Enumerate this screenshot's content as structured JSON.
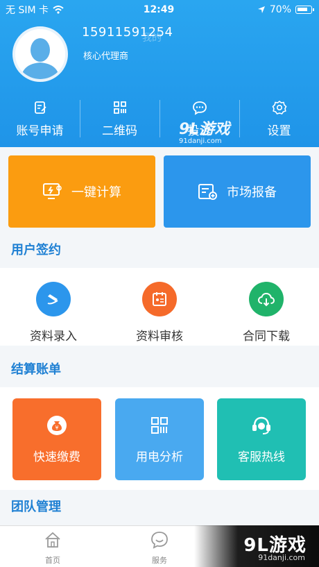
{
  "status_bar": {
    "carrier": "无 SIM 卡",
    "time": "12:49",
    "battery": "70%"
  },
  "profile": {
    "phone": "15911591254",
    "role": "核心代理商",
    "faint_label": "我的"
  },
  "top_menu": [
    {
      "label": "账号申请",
      "icon": "edit-icon"
    },
    {
      "label": "二维码",
      "icon": "qrcode-icon"
    },
    {
      "label": "投诉",
      "icon": "chat-icon"
    },
    {
      "label": "设置",
      "icon": "gear-icon"
    }
  ],
  "actions": {
    "calc": "一键计算",
    "report": "市场报备"
  },
  "section_signing": {
    "title": "用户签约",
    "items": [
      {
        "label": "资料录入",
        "color": "#2c96ec"
      },
      {
        "label": "资料审核",
        "color": "#f56a2a"
      },
      {
        "label": "合同下载",
        "color": "#20b36a"
      }
    ]
  },
  "section_billing": {
    "title": "结算账单",
    "tiles": [
      {
        "label": "快速缴费",
        "color": "#f86e2c"
      },
      {
        "label": "用电分析",
        "color": "#49a9f0"
      },
      {
        "label": "客服热线",
        "color": "#20bfb3"
      }
    ]
  },
  "section_team": {
    "title": "团队管理"
  },
  "tabbar": {
    "home": "首页",
    "service": "服务"
  },
  "watermark": {
    "brand": "9L游戏",
    "site": "91danji.com"
  },
  "colors": {
    "primary": "#2aa6f0",
    "orange": "#fb9c10",
    "blue": "#2c96ec",
    "title_blue": "#1f80d3"
  }
}
